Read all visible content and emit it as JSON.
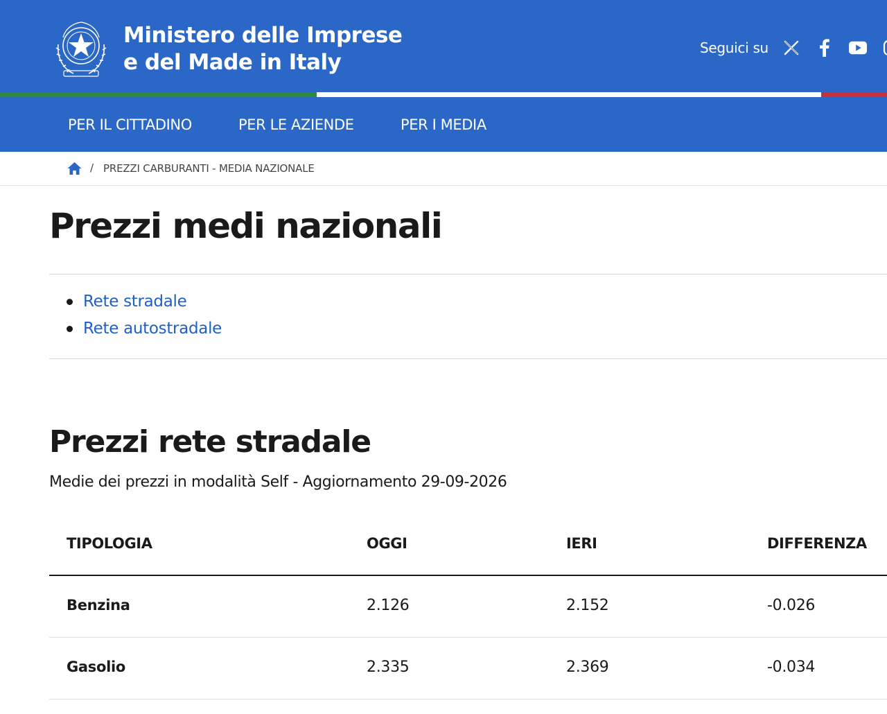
{
  "header": {
    "brand_line1": "Ministero delle Imprese",
    "brand_line2": "e del Made in Italy",
    "social_label": "Seguici su",
    "social_icons": [
      "x-icon",
      "facebook-icon",
      "youtube-icon",
      "instagram-icon"
    ]
  },
  "nav": {
    "items": [
      {
        "label": "PER IL CITTADINO"
      },
      {
        "label": "PER LE AZIENDE"
      },
      {
        "label": "PER I MEDIA"
      }
    ]
  },
  "breadcrumb": {
    "separator": "/",
    "current": "PREZZI CARBURANTI - MEDIA NAZIONALE"
  },
  "main": {
    "title": "Prezzi medi nazionali",
    "links": [
      {
        "label": "Rete stradale"
      },
      {
        "label": "Rete autostradale"
      }
    ],
    "section_title": "Prezzi rete stradale",
    "section_subtitle": "Medie dei prezzi in modalità Self - Aggiornamento 29-09-2026"
  },
  "table": {
    "headers": [
      "TIPOLOGIA",
      "OGGI",
      "IERI",
      "DIFFERENZA"
    ],
    "rows": [
      [
        "Benzina",
        "2.126",
        "2.152",
        "-0.026"
      ],
      [
        "Gasolio",
        "2.335",
        "2.369",
        "-0.034"
      ]
    ]
  },
  "colors": {
    "header_blue": "#2b67c7",
    "link_blue": "#1f5fc6",
    "flag_green": "#2e8b3e",
    "flag_red": "#c8313b"
  }
}
